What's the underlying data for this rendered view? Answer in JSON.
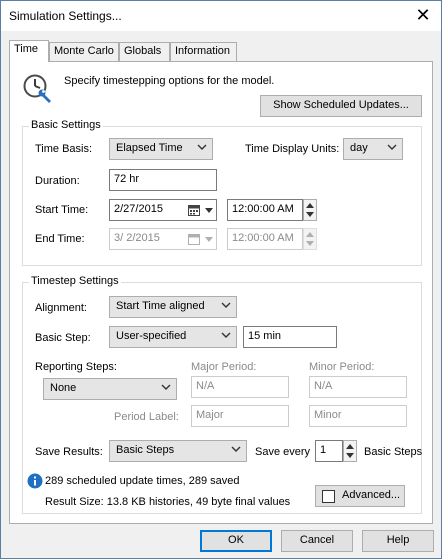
{
  "window": {
    "title": "Simulation Settings...",
    "close_glyph": "✕",
    "close_icon": "close-icon"
  },
  "tabs": [
    {
      "label": "Time",
      "active": true
    },
    {
      "label": "Monte Carlo",
      "active": false
    },
    {
      "label": "Globals",
      "active": false
    },
    {
      "label": "Information",
      "active": false
    }
  ],
  "header": {
    "icon": "clock-wrench-icon",
    "description": "Specify timestepping options for the model.",
    "show_updates_label": "Show Scheduled Updates..."
  },
  "basic_settings": {
    "title": "Basic Settings",
    "time_basis_label": "Time Basis:",
    "time_basis_value": "Elapsed Time",
    "time_display_units_label": "Time Display Units:",
    "time_display_units_value": "day",
    "duration_label": "Duration:",
    "duration_value": "72 hr",
    "start_time_label": "Start Time:",
    "start_date_value": "2/27/2015",
    "start_clock_value": "12:00:00 AM",
    "end_time_label": "End Time:",
    "end_date_value": "3/  2/2015",
    "end_clock_value": "12:00:00 AM"
  },
  "timestep_settings": {
    "title": "Timestep Settings",
    "alignment_label": "Alignment:",
    "alignment_value": "Start Time aligned",
    "basic_step_label": "Basic Step:",
    "basic_step_value": "User-specified",
    "basic_step_length": "15 min",
    "reporting_steps_label": "Reporting Steps:",
    "reporting_steps_value": "None",
    "major_period_label": "Major Period:",
    "major_period_value": "N/A",
    "minor_period_label": "Minor Period:",
    "minor_period_value": "N/A",
    "period_label_label": "Period Label:",
    "period_label_major": "Major",
    "period_label_minor": "Minor",
    "save_results_label": "Save Results:",
    "save_results_value": "Basic Steps",
    "save_every_label": "Save every",
    "save_every_value": "1",
    "save_every_unit": "Basic Steps",
    "info_icon": "info-icon",
    "info_text": "289 scheduled update times, 289 saved",
    "result_size_text": "Result Size: 13.8 KB histories, 49 byte final values",
    "advanced_label": "Advanced..."
  },
  "footer": {
    "ok_label": "OK",
    "cancel_label": "Cancel",
    "help_label": "Help"
  },
  "colors": {
    "window_border": "#5a7fa5",
    "primary_button_border": "#0078d7",
    "info_icon": "#1f6fc2"
  }
}
